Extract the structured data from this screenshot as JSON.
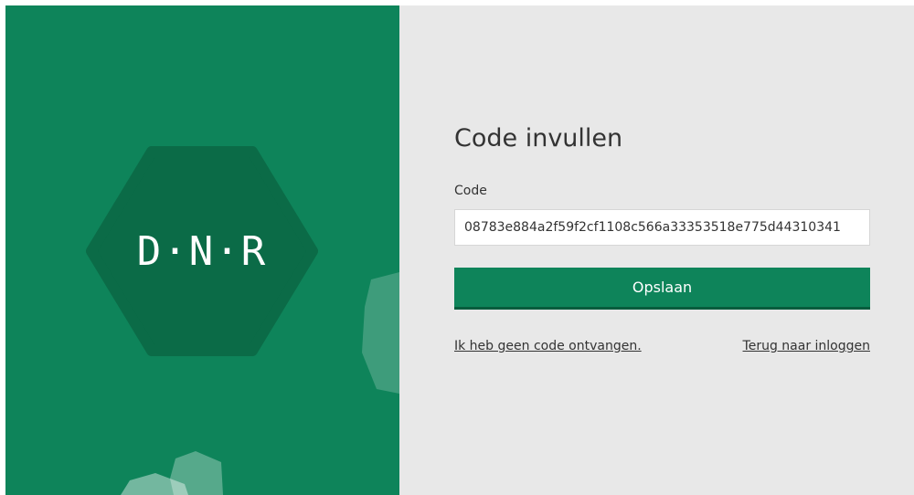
{
  "brand": {
    "logo_text": "D·N·R",
    "panel_color": "#0e845a",
    "hexagon_color": "#0b6b47"
  },
  "form": {
    "title": "Code invullen",
    "code_label": "Code",
    "code_value": "08783e884a2f59f2cf1108c566a33353518e775d44310341",
    "save_label": "Opslaan",
    "no_code_link": "Ik heb geen code ontvangen.",
    "back_link": "Terug naar inloggen"
  },
  "colors": {
    "accent": "#0e845a",
    "background": "#e8e8e8",
    "text": "#333333"
  }
}
